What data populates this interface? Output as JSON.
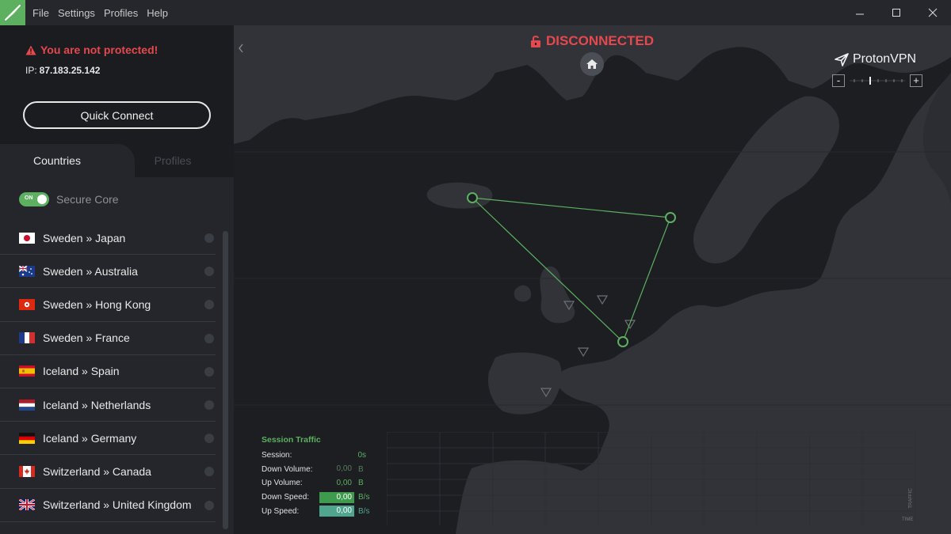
{
  "menu": [
    "File",
    "Settings",
    "Profiles",
    "Help"
  ],
  "status": {
    "warning": "You are not protected!",
    "ip_label": "IP:",
    "ip_value": "87.183.25.142"
  },
  "quick_connect": "Quick Connect",
  "tabs": {
    "countries": "Countries",
    "profiles": "Profiles"
  },
  "secure_core": {
    "toggle": "ON",
    "label": "Secure Core"
  },
  "servers": [
    {
      "label": "Sweden » Japan",
      "flag": "jp"
    },
    {
      "label": "Sweden » Australia",
      "flag": "au"
    },
    {
      "label": "Sweden » Hong Kong",
      "flag": "hk"
    },
    {
      "label": "Sweden » France",
      "flag": "fr"
    },
    {
      "label": "Iceland » Spain",
      "flag": "es"
    },
    {
      "label": "Iceland » Netherlands",
      "flag": "nl"
    },
    {
      "label": "Iceland » Germany",
      "flag": "de"
    },
    {
      "label": "Switzerland » Canada",
      "flag": "ca"
    },
    {
      "label": "Switzerland » United Kingdom",
      "flag": "gb"
    }
  ],
  "map": {
    "status": "DISCONNECTED",
    "brand": "ProtonVPN",
    "zoom_minus": "-",
    "zoom_plus": "+"
  },
  "traffic": {
    "title": "Session Traffic",
    "session_label": "Session:",
    "session_value": "0s",
    "down_volume_label": "Down Volume:",
    "down_volume_value": "0,00",
    "down_volume_unit": "B",
    "up_volume_label": "Up Volume:",
    "up_volume_value": "0,00",
    "up_volume_unit": "B",
    "down_speed_label": "Down Speed:",
    "down_speed_value": "0,00",
    "down_speed_unit": "B/s",
    "up_speed_label": "Up Speed:",
    "up_speed_value": "0,00",
    "up_speed_unit": "B/s",
    "graph_y": "TRAFFIC",
    "graph_x": "TIME"
  },
  "colors": {
    "accent": "#5cb05f",
    "danger": "#e5484d",
    "panel": "#24262b",
    "dark": "#1b1c20"
  }
}
